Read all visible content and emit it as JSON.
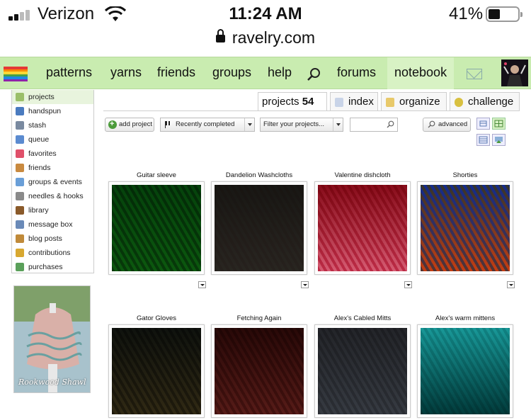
{
  "status_bar": {
    "carrier": "Verizon",
    "time": "11:24 AM",
    "battery_percent": "41%",
    "battery_level": 0.41,
    "url": "ravelry.com"
  },
  "nav": {
    "items": [
      "patterns",
      "yarns",
      "friends",
      "groups",
      "help",
      "forums",
      "notebook"
    ],
    "icons": [
      "rainbow-flag-logo",
      "search-icon",
      "mail-icon",
      "user-avatar"
    ],
    "active": "notebook"
  },
  "sidebar": {
    "items": [
      {
        "label": "projects",
        "icon": "projects-icon",
        "color": "#9bbf6a"
      },
      {
        "label": "handspun",
        "icon": "handspun-icon",
        "color": "#4a7bbf"
      },
      {
        "label": "stash",
        "icon": "stash-icon",
        "color": "#7a8aa0"
      },
      {
        "label": "queue",
        "icon": "queue-icon",
        "color": "#5b8bd0"
      },
      {
        "label": "favorites",
        "icon": "heart-icon",
        "color": "#e0506a"
      },
      {
        "label": "friends",
        "icon": "friends-icon",
        "color": "#c98a40"
      },
      {
        "label": "groups & events",
        "icon": "groups-icon",
        "color": "#6a9fd8"
      },
      {
        "label": "needles & hooks",
        "icon": "needles-icon",
        "color": "#8a8a8a"
      },
      {
        "label": "library",
        "icon": "library-icon",
        "color": "#8a5a2a"
      },
      {
        "label": "message box",
        "icon": "message-icon",
        "color": "#6a8ab8"
      },
      {
        "label": "blog posts",
        "icon": "blog-icon",
        "color": "#c08a3a"
      },
      {
        "label": "contributions",
        "icon": "pencil-icon",
        "color": "#d8a830"
      },
      {
        "label": "purchases",
        "icon": "purchases-icon",
        "color": "#5aa05a"
      }
    ],
    "active": "projects",
    "promo": {
      "label": "Rookwood Shawl"
    }
  },
  "tabs": {
    "projects_label": "projects",
    "projects_count": "54",
    "index": "index",
    "organize": "organize",
    "challenge": "challenge"
  },
  "toolbar": {
    "add_project": "add project",
    "sort_selected": "Recently completed",
    "filter_placeholder": "Filter your projects...",
    "search_value": "",
    "advanced": "advanced"
  },
  "projects": [
    {
      "title": "Guitar sleeve",
      "palette": [
        "#1d5a22",
        "#2f8a32",
        "#1a7a3a",
        "#3fa24a"
      ]
    },
    {
      "title": "Dandelion Washcloths",
      "palette": [
        "#e8a7ae",
        "#f0bcc3",
        "#1a1f1a",
        "#2b332b"
      ]
    },
    {
      "title": "Valentine dishcloth",
      "palette": [
        "#c72e4a",
        "#e06078",
        "#9a1e36",
        "#f2f2f2"
      ]
    },
    {
      "title": "Shorties",
      "palette": [
        "#5a3fb0",
        "#d94b3a",
        "#3ab0c8",
        "#e8d04a"
      ]
    },
    {
      "title": "Gator Gloves",
      "palette": [
        "#3a4038",
        "#5a6458",
        "#2a2e28",
        "#8a6a3a"
      ]
    },
    {
      "title": "Fetching Again",
      "palette": [
        "#6a2e2a",
        "#8a4a44",
        "#4a1e1c",
        "#a0605a"
      ]
    },
    {
      "title": "Alex's Cabled Mitts",
      "palette": [
        "#7a7e86",
        "#9aa0a8",
        "#3a3a3e",
        "#5a5e64"
      ]
    },
    {
      "title": "Alex's warm mittens",
      "palette": [
        "#128a8a",
        "#1aa0a0",
        "#f2f2f2",
        "#0a5e5e"
      ]
    }
  ]
}
